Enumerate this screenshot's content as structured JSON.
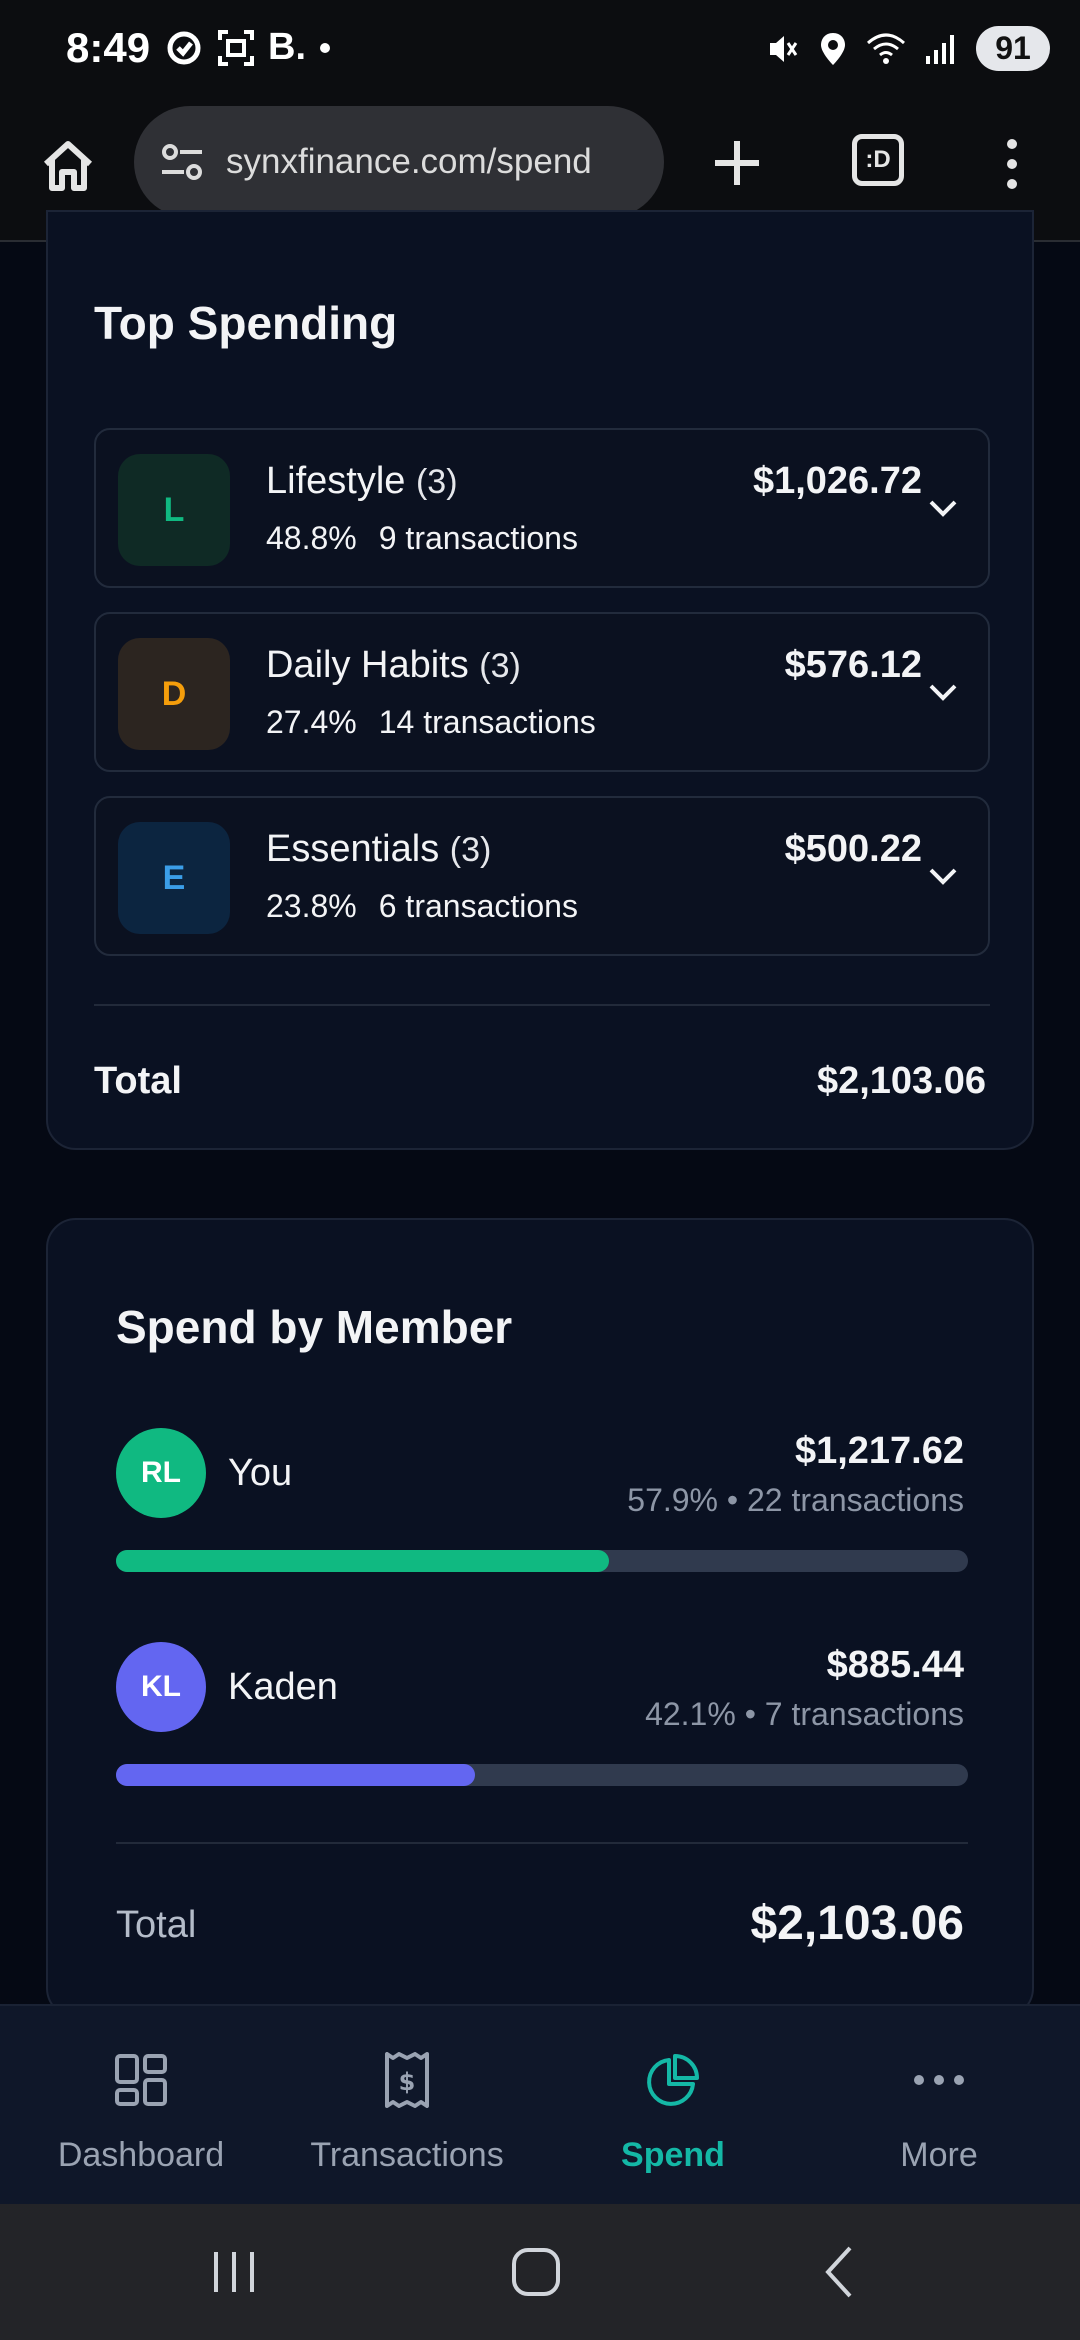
{
  "status_bar": {
    "time": "8:49",
    "left_icons": [
      "sync-icon",
      "screenshot-icon",
      "b-icon",
      "dot-icon"
    ],
    "left_text": "B.",
    "battery": "91"
  },
  "browser": {
    "url": "synxfinance.com/spend",
    "tabs_label": ":D"
  },
  "top_spending": {
    "title": "Top Spending",
    "categories": [
      {
        "letter": "L",
        "name": "Lifestyle",
        "count": "(3)",
        "percent": "48.8%",
        "transactions": "9 transactions",
        "amount": "$1,026.72",
        "badge_bg": "#0f2a25",
        "badge_fg": "#10b981"
      },
      {
        "letter": "D",
        "name": "Daily Habits",
        "count": "(3)",
        "percent": "27.4%",
        "transactions": "14 transactions",
        "amount": "$576.12",
        "badge_bg": "#2c2520",
        "badge_fg": "#f59e0b"
      },
      {
        "letter": "E",
        "name": "Essentials",
        "count": "(3)",
        "percent": "23.8%",
        "transactions": "6 transactions",
        "amount": "$500.22",
        "badge_bg": "#0c2540",
        "badge_fg": "#3b9ee8"
      }
    ],
    "total_label": "Total",
    "total_value": "$2,103.06"
  },
  "spend_by_member": {
    "title": "Spend by Member",
    "members": [
      {
        "initials": "RL",
        "name": "You",
        "amount": "$1,217.62",
        "meta": "57.9% • 22 transactions",
        "share": 0.579,
        "color": "#10b981"
      },
      {
        "initials": "KL",
        "name": "Kaden",
        "amount": "$885.44",
        "meta": "42.1% • 7 transactions",
        "share": 0.421,
        "color": "#6366f1"
      }
    ],
    "total_label": "Total",
    "total_value": "$2,103.06"
  },
  "bottom_nav": {
    "items": [
      {
        "label": "Dashboard",
        "icon": "grid-icon"
      },
      {
        "label": "Transactions",
        "icon": "receipt-icon"
      },
      {
        "label": "Spend",
        "icon": "pie-chart-icon",
        "active": true
      },
      {
        "label": "More",
        "icon": "more-dots-icon"
      }
    ]
  },
  "colors": {
    "accent": "#14b8a6",
    "background": "#050914",
    "card": "#0a1122"
  }
}
